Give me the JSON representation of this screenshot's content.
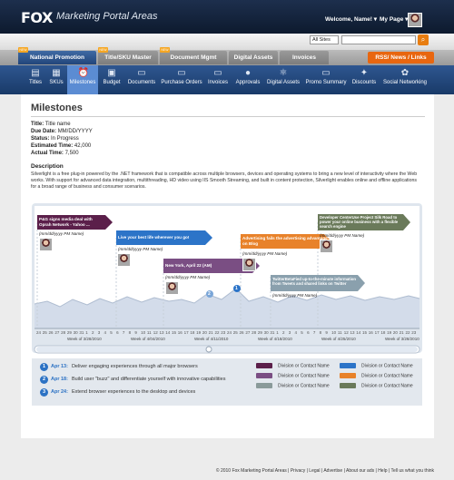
{
  "header": {
    "logo": "FOX",
    "portal": "Marketing Portal Areas",
    "welcome": "Welcome, Name! ▾",
    "mypage": "My Page ▾"
  },
  "search": {
    "scope": "All Sites",
    "placeholder": "",
    "go": "⌕"
  },
  "tabs": [
    {
      "label": "National Promotion"
    },
    {
      "label": "Title/SKU Master"
    },
    {
      "label": "Document Mgmt"
    },
    {
      "label": "Digital Assets"
    },
    {
      "label": "Invoices"
    }
  ],
  "new_badge": "NEW",
  "rss": "RSS/ News / Links",
  "nav": [
    {
      "label": "Titles",
      "icon": "▤"
    },
    {
      "label": "SKUs",
      "icon": "▦"
    },
    {
      "label": "Milestones",
      "icon": "⏰"
    },
    {
      "label": "Budget",
      "icon": "▣"
    },
    {
      "label": "Documents",
      "icon": "▭"
    },
    {
      "label": "Purchase Orders",
      "icon": "▭"
    },
    {
      "label": "Invoices",
      "icon": "▭"
    },
    {
      "label": "Approvals",
      "icon": "●"
    },
    {
      "label": "Digital Assets",
      "icon": "⚛"
    },
    {
      "label": "Promo Summary",
      "icon": "▭"
    },
    {
      "label": "Discounts",
      "icon": "✦"
    },
    {
      "label": "Social Networking",
      "icon": "✿"
    }
  ],
  "page": {
    "title": "Milestones",
    "meta": [
      {
        "k": "Title:",
        "v": "Title name"
      },
      {
        "k": "Due Date:",
        "v": "MM/DD/YYYY"
      },
      {
        "k": "Status:",
        "v": "In Progress"
      },
      {
        "k": "Estimated Time:",
        "v": "42,000"
      },
      {
        "k": "Actual Time:",
        "v": "7,500"
      }
    ],
    "desc_title": "Description",
    "desc": "Silverlight is a free plug-in powered by the .NET framework that is compatible across multiple browsers, devices and operating systems to bring a new level of interactivity where the Web works. With support for advanced data integration, multithreading, HD video using IIS Smooth Streaming, and built in content protection, Silverlight enables online and offline applications for a broad range of business and consumer scenarios."
  },
  "timeline": {
    "events": [
      {
        "text": "P&G signs media deal with Oprah Network - Yahoo ...",
        "sub": "(mm/dd/yyyy PM Name)",
        "color": "#5b1f4a"
      },
      {
        "text": "Live your best life wherever you go!",
        "sub": "(mm/dd/yyyy PM Name)",
        "color": "#2c74c8"
      },
      {
        "text": "New York, April 22 (AM)",
        "sub": "(mm/dd/yyyy PM Name)",
        "color": "#7a4e83"
      },
      {
        "text": "Advertising fails the advertising advantage on Blog",
        "sub": "(mm/dd/yyyy PM Name)",
        "color": "#e8822a"
      },
      {
        "text": "Developer CenterUse Project Silk Road to power your online business with a flexible search engine",
        "sub": "(mm/dd/yyyy PM Name)",
        "color": "#6a7a5a"
      },
      {
        "text": "TwitterBetaFied up-to-the-minute information from Tweets and shared links on Twitter",
        "sub": "(mm/dd/yyyy PM Name)",
        "color": "#8aa0ad"
      }
    ],
    "markers": [
      "2",
      "1"
    ],
    "days": [
      "24",
      "25",
      "26",
      "27",
      "28",
      "29",
      "30",
      "31",
      "1",
      "2",
      "3",
      "4",
      "5",
      "6",
      "7",
      "8",
      "9",
      "10",
      "11",
      "12",
      "13",
      "14",
      "15",
      "16",
      "17",
      "18",
      "19",
      "20",
      "21",
      "22",
      "23",
      "24",
      "25",
      "26",
      "27",
      "28",
      "29",
      "30",
      "31",
      "1",
      "2",
      "3",
      "4",
      "5",
      "6",
      "7",
      "8",
      "9",
      "10",
      "11",
      "12",
      "13",
      "14",
      "15",
      "16",
      "17",
      "18",
      "19",
      "20",
      "21",
      "22",
      "23"
    ],
    "weeks": [
      "Week of 3/28/2010",
      "Week of 4/04/2010",
      "Week of 4/11/2010",
      "Week of 4/18/2010",
      "Week of 4/25/2010",
      "Week of 3/28/2010"
    ]
  },
  "notes": [
    {
      "n": "1",
      "date": "Apr 13:",
      "text": "Deliver engaging experiences through all major browsers"
    },
    {
      "n": "2",
      "date": "Apr 18:",
      "text": "Build user \"buzz\" and differentiate yourself with innovative capabilities"
    },
    {
      "n": "3",
      "date": "Apr 24:",
      "text": "Extend browser experiences to the desktop and devices"
    }
  ],
  "legend": [
    {
      "label": "Division or Contact Name",
      "color": "#5b1f4a"
    },
    {
      "label": "Division or Contact Name",
      "color": "#2c74c8"
    },
    {
      "label": "Division or Contact Name",
      "color": "#7a4e83"
    },
    {
      "label": "Division or Contact Name",
      "color": "#e8822a"
    },
    {
      "label": "Division or Contact Name",
      "color": "#8a9a9a"
    },
    {
      "label": "Division or Contact Name",
      "color": "#6a7a5a"
    }
  ],
  "footer": "© 2010 Fox Marketing Portal Areas | Privacy | Legal | Advertise | About our ads | Help | Tell us what you think"
}
